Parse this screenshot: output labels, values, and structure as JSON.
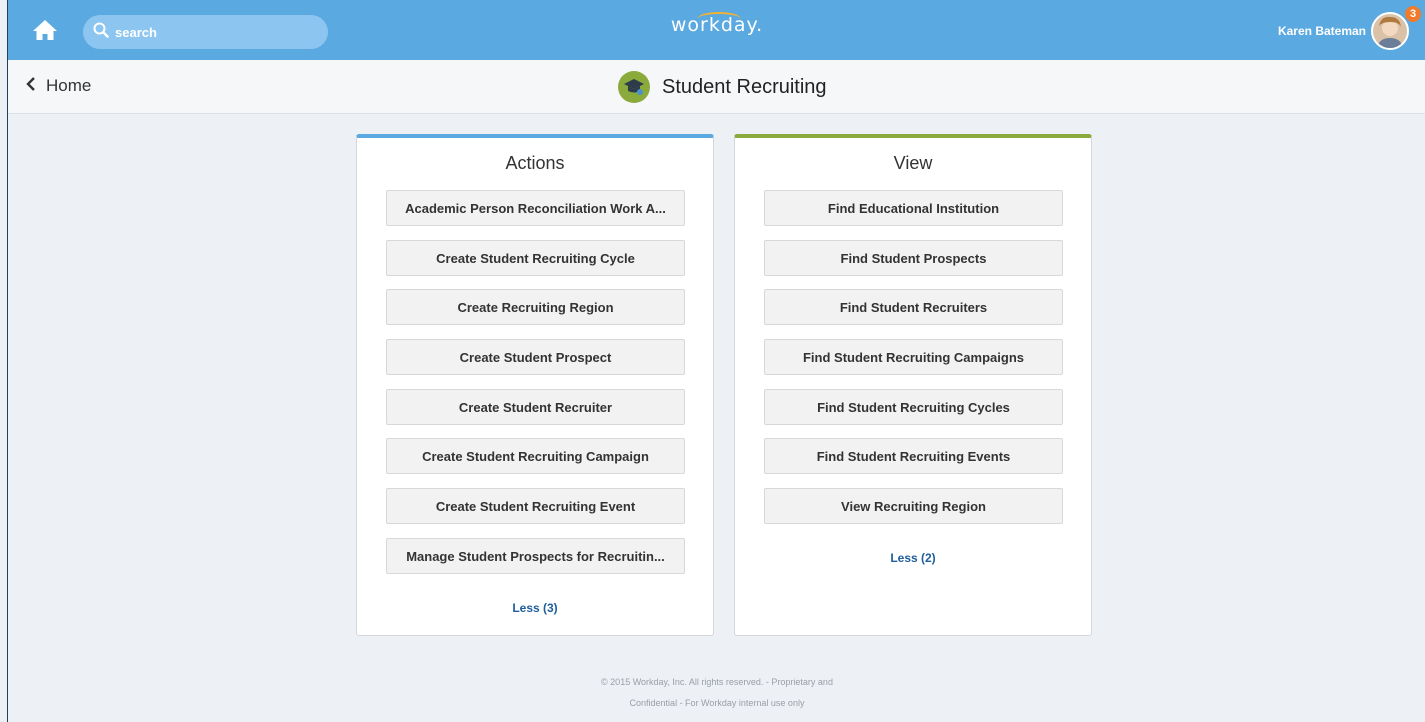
{
  "header": {
    "search_placeholder": "search",
    "logo_text": "workday.",
    "user_name": "Karen Bateman",
    "notification_count": "3"
  },
  "subheader": {
    "back_label": "Home",
    "page_title": "Student Recruiting"
  },
  "actions": {
    "title": "Actions",
    "items": [
      "Academic Person Reconciliation Work A...",
      "Create Student Recruiting Cycle",
      "Create Recruiting Region",
      "Create Student Prospect",
      "Create Student Recruiter",
      "Create Student Recruiting Campaign",
      "Create Student Recruiting Event",
      "Manage Student Prospects for Recruitin..."
    ],
    "less_label": "Less (3)"
  },
  "view": {
    "title": "View",
    "items": [
      "Find Educational Institution",
      "Find Student Prospects",
      "Find Student Recruiters",
      "Find Student Recruiting Campaigns",
      "Find Student Recruiting Cycles",
      "Find Student Recruiting Events",
      "View Recruiting Region"
    ],
    "less_label": "Less (2)"
  },
  "footer": {
    "line1": "© 2015 Workday, Inc. All rights reserved. - Proprietary and",
    "line2": "Confidential - For Workday internal use only"
  },
  "colors": {
    "topbar": "#5aa9e0",
    "actions_accent": "#5aa9e0",
    "view_accent": "#8aaa3b",
    "link": "#1f5e9c",
    "badge": "#f07b2c"
  }
}
